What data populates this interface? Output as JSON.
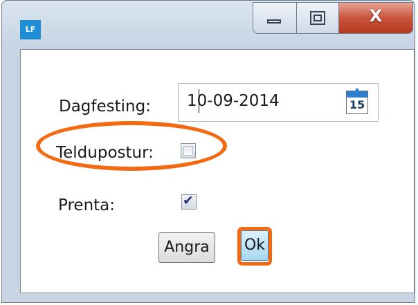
{
  "window": {
    "icon_text": "LF",
    "close_glyph": "X",
    "icons": [
      "minimize-icon",
      "maximize-icon",
      "close-icon",
      "calendar-icon"
    ]
  },
  "form": {
    "date_label": "Dagfesting:",
    "date_value": "10-09-2014",
    "calendar_day": "15",
    "email_label": "Teldupostur:",
    "email_checked": false,
    "print_label": "Prenta:",
    "print_checked": true
  },
  "buttons": {
    "cancel_label": "Angra",
    "ok_label": "Ok"
  },
  "colors": {
    "highlight": "#f26b14",
    "accent": "#1e8fd6"
  }
}
